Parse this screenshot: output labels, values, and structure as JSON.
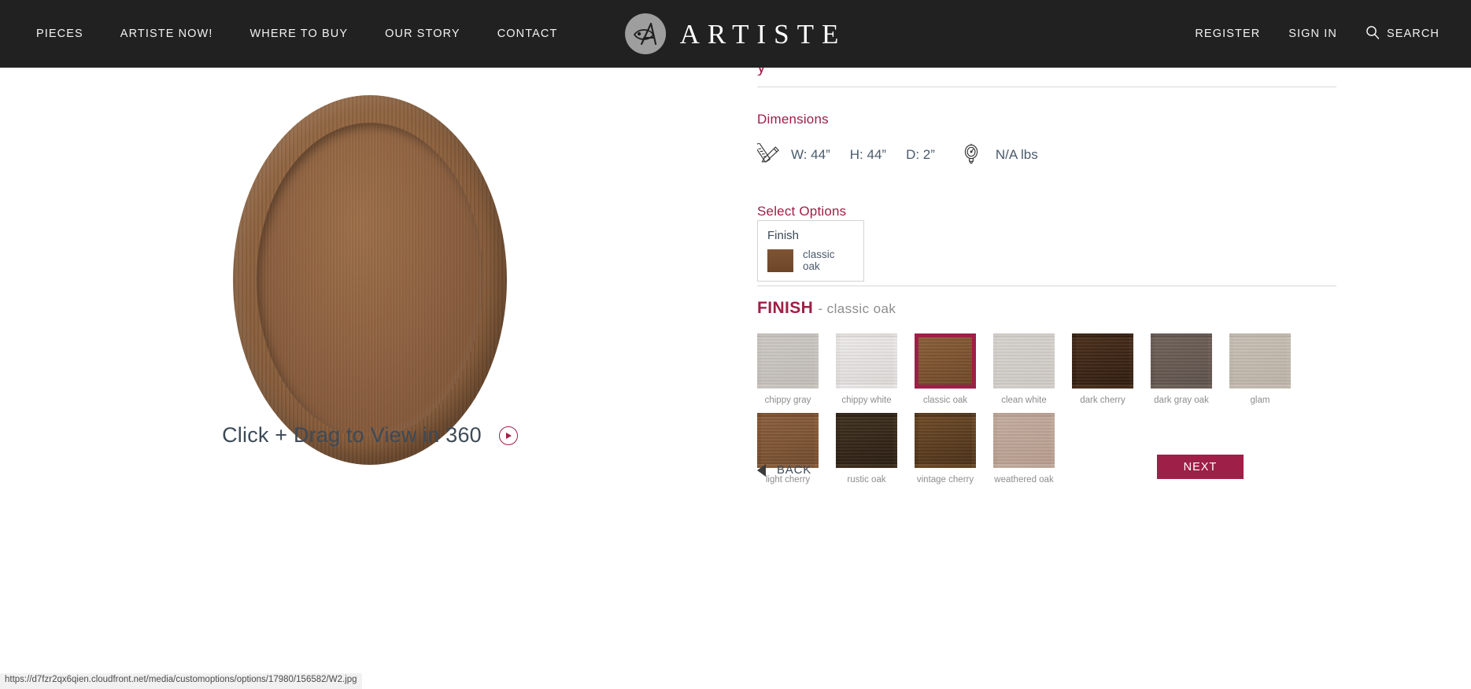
{
  "header": {
    "brand": "ARTISTE",
    "nav_left": [
      {
        "label": "PIECES"
      },
      {
        "label": "ARTISTE NOW!"
      },
      {
        "label": "WHERE TO BUY"
      },
      {
        "label": "OUR STORY"
      },
      {
        "label": "CONTACT"
      }
    ],
    "nav_right": [
      {
        "label": "REGISTER"
      },
      {
        "label": "SIGN IN"
      },
      {
        "label": "SEARCH",
        "icon": "search-icon"
      }
    ],
    "background_color": "#212121",
    "logo_icon": "artiste-monogram-icon"
  },
  "viewer": {
    "rotate_label": "Click + Drag to View in 360",
    "play_icon": "play-circle-icon",
    "product_alt": "round oak mirror in classic oak finish"
  },
  "panel": {
    "clipped_title": "y",
    "dimensions": {
      "heading": "Dimensions",
      "ruler_icon": "ruler-pencil-icon",
      "width": "W: 44”",
      "height": "H: 44”",
      "depth": "D: 2”",
      "weight_icon": "scale-icon",
      "weight": "N/A lbs"
    },
    "select_options": {
      "heading": "Select Options",
      "card": {
        "name": "Finish",
        "value": "classic oak",
        "swatch_color": "#7f5434"
      }
    },
    "finish": {
      "title": "FINISH",
      "subtitle": "- classic oak",
      "selected": "classic oak",
      "accent_color": "#9e1f47",
      "swatches": [
        {
          "name": "chippy gray",
          "color": "#cdc8c3",
          "color2": "#c2bdb8"
        },
        {
          "name": "chippy white",
          "color": "#eceaea",
          "color2": "#ddd9d6"
        },
        {
          "name": "classic oak",
          "color": "#8a5e38",
          "color2": "#6e4827",
          "selected": true
        },
        {
          "name": "clean white",
          "color": "#d6d2cd",
          "color2": "#cfcac5"
        },
        {
          "name": "dark cherry",
          "color": "#4a2f1c",
          "color2": "#301c0f"
        },
        {
          "name": "dark gray oak",
          "color": "#6f625a",
          "color2": "#5e524b"
        },
        {
          "name": "glam",
          "color": "#c8bfb5",
          "color2": "#bdb3a8"
        },
        {
          "name": "light cherry",
          "color": "#8a5f3d",
          "color2": "#724b2d"
        },
        {
          "name": "rustic oak",
          "color": "#40301f",
          "color2": "#2a1e12"
        },
        {
          "name": "vintage cherry",
          "color": "#6d4a27",
          "color2": "#4b3118"
        },
        {
          "name": "weathered oak",
          "color": "#c4ada0",
          "color2": "#b69c8d"
        }
      ]
    },
    "footer": {
      "back_label": "BACK",
      "back_icon": "triangle-left-icon",
      "next_label": "NEXT"
    }
  },
  "status_bar": {
    "url": "https://d7fzr2qx6qien.cloudfront.net/media/customoptions/options/17980/156582/W2.jpg"
  }
}
